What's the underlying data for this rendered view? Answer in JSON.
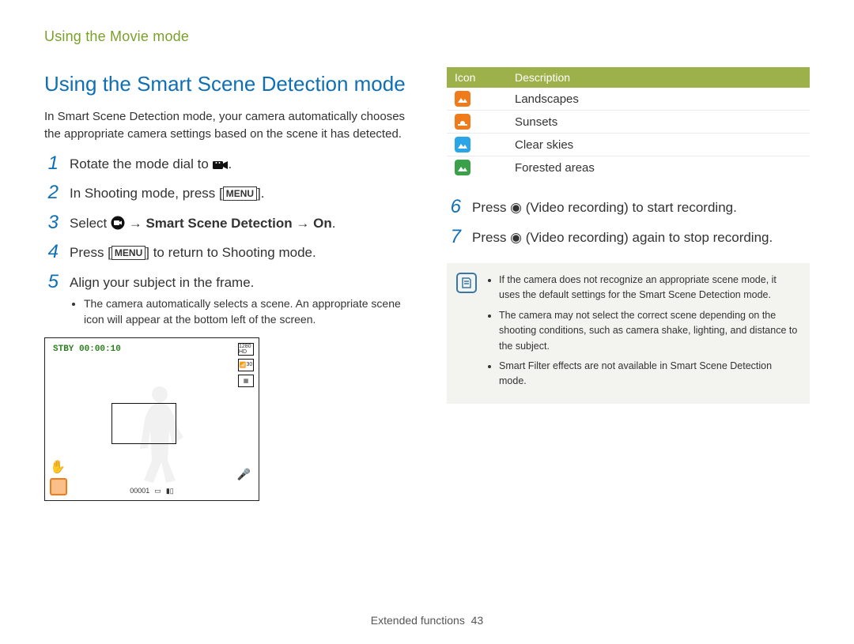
{
  "breadcrumb": "Using the Movie mode",
  "section_title": "Using the Smart Scene Detection mode",
  "intro": "In Smart Scene Detection mode, your camera automatically chooses the appropriate camera settings based on the scene it has detected.",
  "steps": {
    "s1_pre": "Rotate the mode dial to ",
    "s1_post": ".",
    "s2_pre": "In Shooting mode, press [",
    "s2_menu": "MENU",
    "s2_post": "].",
    "s3_pre": "Select ",
    "s3_arrow": " → ",
    "s3_bold1": "Smart Scene Detection",
    "s3_bold2": "On",
    "s3_post": ".",
    "s4_pre": "Press [",
    "s4_menu": "MENU",
    "s4_post": "] to return to Shooting mode.",
    "s5": "Align your subject in the frame.",
    "s5_bullet": "The camera automatically selects a scene. An appropriate scene icon will appear at the bottom left of the screen.",
    "s6": "Press ◉ (Video recording) to start recording.",
    "s7": "Press ◉ (Video recording) again to stop recording."
  },
  "preview": {
    "stby": "STBY",
    "time": "00:00:10",
    "hd": "1280 HD",
    "fps": "30",
    "shots": "00001"
  },
  "table": {
    "h_icon": "Icon",
    "h_desc": "Description",
    "rows": [
      {
        "label": "Landscapes",
        "color": "#f07b1a"
      },
      {
        "label": "Sunsets",
        "color": "#f07b1a"
      },
      {
        "label": "Clear skies",
        "color": "#2aa5e6"
      },
      {
        "label": "Forested areas",
        "color": "#3aa04a"
      }
    ]
  },
  "notes": [
    "If the camera does not recognize an appropriate scene mode, it uses the default settings for the Smart Scene Detection mode.",
    "The camera may not select the correct scene depending on the shooting conditions, such as camera shake, lighting, and distance to the subject.",
    "Smart Filter effects are not available in Smart Scene Detection mode."
  ],
  "footer_label": "Extended functions",
  "footer_page": "43"
}
